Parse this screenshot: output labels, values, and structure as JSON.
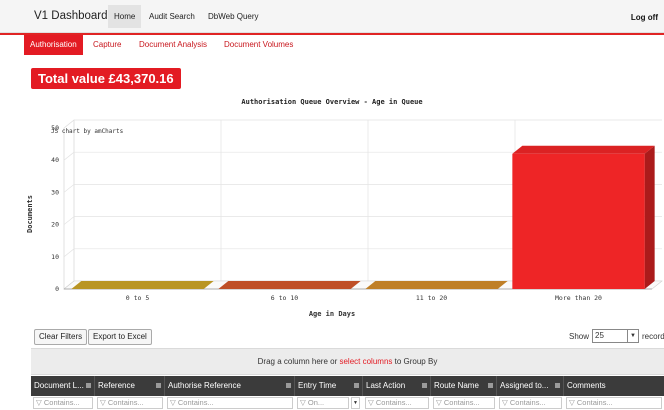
{
  "app": {
    "brand": "V1 Dashboard"
  },
  "nav": {
    "items": [
      "Home",
      "Audit Search",
      "DbWeb Query"
    ],
    "logoff": "Log off"
  },
  "subnav": {
    "tabs": [
      "Authorisation",
      "Capture",
      "Document Analysis",
      "Document Volumes"
    ],
    "active": "Authorisation"
  },
  "total": {
    "label": "Total value £43,370.16"
  },
  "chart_data": {
    "type": "bar",
    "title": "Authorisation Queue Overview - Age in Queue",
    "credit": "JS chart by amCharts",
    "categories": [
      "0 to 5",
      "6 to 10",
      "11 to 20",
      "More than 20"
    ],
    "values": [
      0,
      0,
      0,
      42
    ],
    "colors": [
      "#c9a227",
      "#d0562a",
      "#d08a2a",
      "#ee2526"
    ],
    "xlabel": "Age in Days",
    "ylabel": "Documents",
    "ylim": [
      0,
      50
    ],
    "yticks": [
      0,
      10,
      20,
      30,
      40,
      50
    ],
    "style": "3d",
    "grid": true
  },
  "toolbar": {
    "clear_filters": "Clear Filters",
    "export": "Export to Excel",
    "show": "Show",
    "page_size": "25",
    "records": "records"
  },
  "group_bar": {
    "before": "Drag a column here or ",
    "link": "select columns",
    "after": " to Group By"
  },
  "grid": {
    "columns": [
      "Document L...",
      "Reference",
      "Authorise Reference",
      "Entry Time",
      "Last Action",
      "Route Name",
      "Assigned to...",
      "Comments"
    ],
    "filters": [
      "Contains...",
      "Contains...",
      "Contains...",
      "On...",
      "Contains...",
      "Contains...",
      "Contains...",
      "Contains..."
    ],
    "filter_icon": "▽"
  },
  "colors": {
    "accent": "#e31b23",
    "header_bg": "#3b3b3b"
  }
}
